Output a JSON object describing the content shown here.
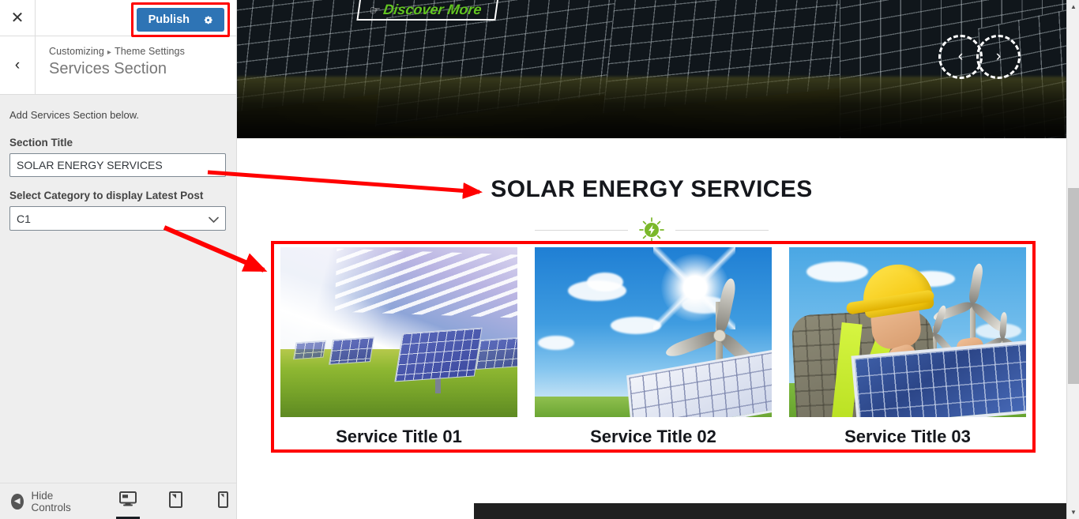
{
  "sidebar": {
    "close_label": "✕",
    "publish_label": "Publish",
    "gear_icon": "gear-icon",
    "back_label": "‹",
    "breadcrumb_root": "Customizing",
    "breadcrumb_sep": "▸",
    "breadcrumb_parent": "Theme Settings",
    "panel_title": "Services Section",
    "description": "Add Services Section below.",
    "fields": [
      {
        "label": "Section Title",
        "value": "SOLAR ENERGY SERVICES",
        "type": "text"
      },
      {
        "label": "Select Category to display Latest Post",
        "value": "C1",
        "type": "select",
        "chevron": "chevron-down-icon"
      }
    ],
    "footer": {
      "hide_controls_label": "Hide Controls",
      "hide_controls_icon": "arrow-left-circle-icon",
      "devices": [
        {
          "name": "desktop",
          "icon": "desktop-icon",
          "active": true
        },
        {
          "name": "tablet",
          "icon": "tablet-icon",
          "active": false
        },
        {
          "name": "mobile",
          "icon": "mobile-icon",
          "active": false
        }
      ]
    }
  },
  "preview": {
    "hero": {
      "cta_label": "Discover More",
      "cta_icon": "pointing-hand-icon",
      "prev_label": "‹",
      "next_label": "›",
      "alt": "solar panel field at dusk"
    },
    "section": {
      "title": "SOLAR ENERGY SERVICES",
      "divider_icon": "lightning-bolt-badge-icon",
      "cards": [
        {
          "title": "Service Title 01",
          "image_alt": "solar panels in grass field under blue sky"
        },
        {
          "title": "Service Title 02",
          "image_alt": "wind turbine and solar panel on green hill"
        },
        {
          "title": "Service Title 03",
          "image_alt": "worker in yellow hard hat installing solar panel"
        }
      ]
    }
  },
  "scrollbar": {
    "up_label": "▲",
    "down_label": "▼"
  },
  "colors": {
    "publish_blue": "#2e74b5",
    "annotation_red": "#ff0000",
    "accent_green": "#7ab829",
    "cta_green": "#62c422"
  }
}
